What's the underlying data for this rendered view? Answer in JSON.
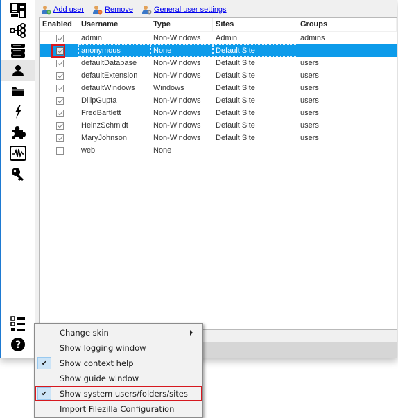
{
  "sidebar": {
    "items": [
      {
        "name": "dashboard",
        "icon": "dashboard-icon"
      },
      {
        "name": "network",
        "icon": "network-tree-icon"
      },
      {
        "name": "servers",
        "icon": "server-stack-icon"
      },
      {
        "name": "users",
        "icon": "user-icon",
        "active": true
      },
      {
        "name": "folders",
        "icon": "folder-icon"
      },
      {
        "name": "events",
        "icon": "lightning-icon"
      },
      {
        "name": "plugins",
        "icon": "puzzle-icon"
      },
      {
        "name": "monitor",
        "icon": "activity-monitor-icon"
      },
      {
        "name": "keys",
        "icon": "key-icon"
      }
    ],
    "bottom_items": [
      {
        "name": "menu",
        "icon": "list-menu-icon"
      },
      {
        "name": "help",
        "icon": "help-icon"
      }
    ]
  },
  "toolbar": {
    "add_user": "Add user",
    "remove": "Remove",
    "general_settings": "General user settings"
  },
  "table": {
    "headers": {
      "enabled": "Enabled",
      "username": "Username",
      "type": "Type",
      "sites": "Sites",
      "groups": "Groups"
    },
    "rows": [
      {
        "enabled": true,
        "username": "admin",
        "type": "Non-Windows",
        "sites": "Admin",
        "groups": "admins"
      },
      {
        "enabled": true,
        "username": "anonymous",
        "type": "None",
        "sites": "Default Site",
        "groups": "",
        "selected": true
      },
      {
        "enabled": true,
        "username": "defaultDatabase",
        "type": "Non-Windows",
        "sites": "Default Site",
        "groups": "users"
      },
      {
        "enabled": true,
        "username": "defaultExtension",
        "type": "Non-Windows",
        "sites": "Default Site",
        "groups": "users"
      },
      {
        "enabled": true,
        "username": "defaultWindows",
        "type": "Windows",
        "sites": "Default Site",
        "groups": "users"
      },
      {
        "enabled": true,
        "username": "DilipGupta",
        "type": "Non-Windows",
        "sites": "Default Site",
        "groups": "users"
      },
      {
        "enabled": true,
        "username": "FredBartlett",
        "type": "Non-Windows",
        "sites": "Default Site",
        "groups": "users"
      },
      {
        "enabled": true,
        "username": "HeinzSchmidt",
        "type": "Non-Windows",
        "sites": "Default Site",
        "groups": "users"
      },
      {
        "enabled": true,
        "username": "MaryJohnson",
        "type": "Non-Windows",
        "sites": "Default Site",
        "groups": "users"
      },
      {
        "enabled": false,
        "username": "web",
        "type": "None",
        "sites": "",
        "groups": ""
      }
    ]
  },
  "context_menu": {
    "items": [
      {
        "label": "Change skin",
        "checked": false,
        "submenu": true
      },
      {
        "label": "Show logging window",
        "checked": false
      },
      {
        "label": "Show context help",
        "checked": true
      },
      {
        "label": "Show guide window",
        "checked": false
      },
      {
        "label": "Show system users/folders/sites",
        "checked": true,
        "highlighted": true
      },
      {
        "label": "Import Filezilla Configuration",
        "checked": false
      }
    ]
  },
  "colors": {
    "selection": "#0d9bea",
    "highlight_box": "#d6181f",
    "window_border": "#1e7ad2",
    "link": "#0000ee"
  }
}
